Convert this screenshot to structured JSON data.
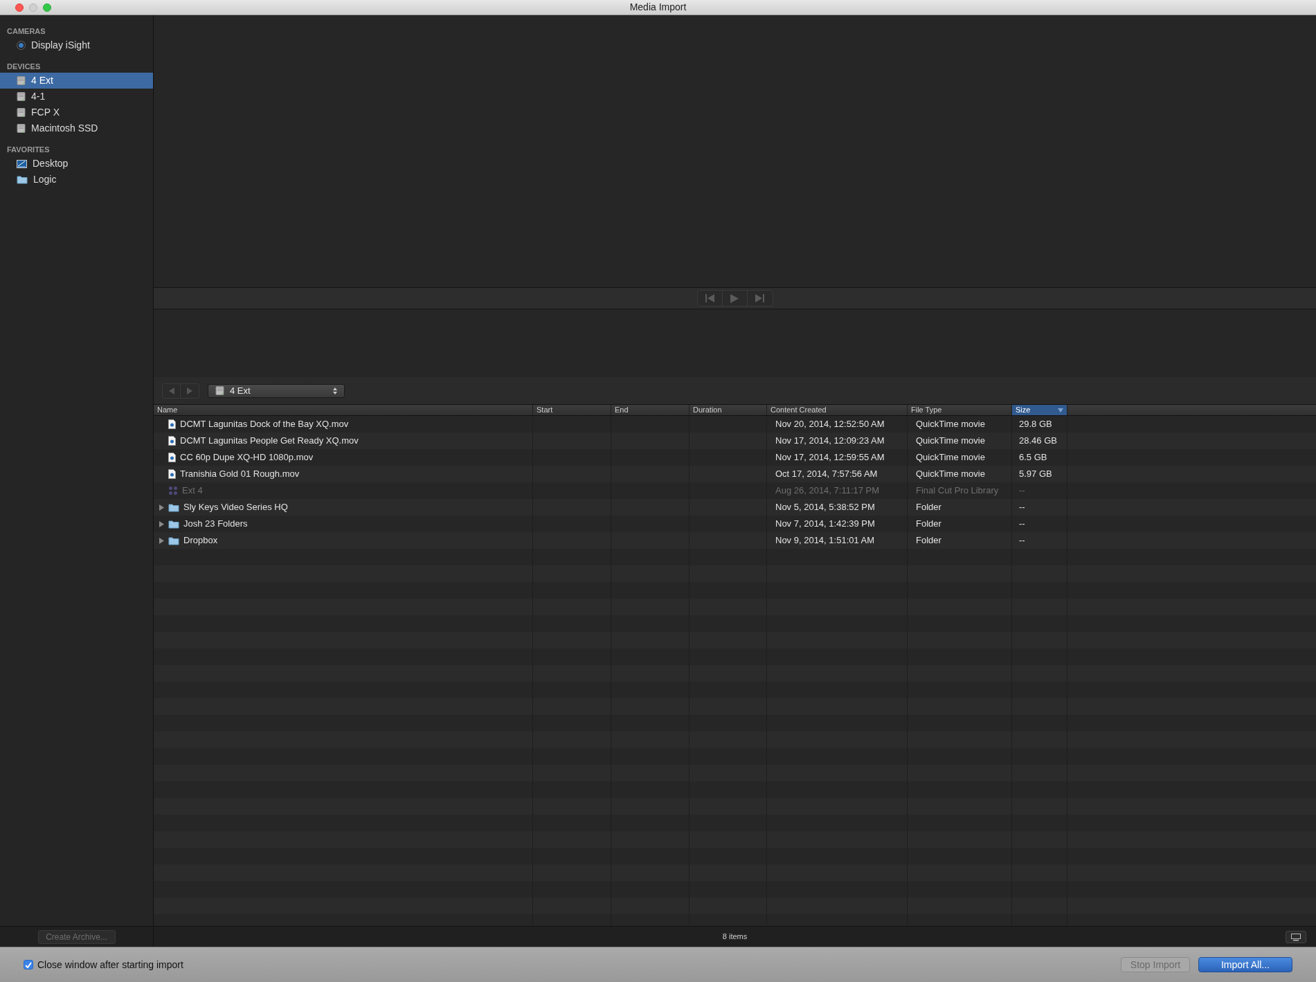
{
  "window": {
    "title": "Media Import"
  },
  "sidebar": {
    "sections": [
      {
        "title": "CAMERAS",
        "items": [
          {
            "label": "Display iSight",
            "kind": "camera",
            "selected": false
          }
        ]
      },
      {
        "title": "DEVICES",
        "items": [
          {
            "label": "4 Ext",
            "kind": "disk",
            "selected": true
          },
          {
            "label": "4-1",
            "kind": "disk",
            "selected": false
          },
          {
            "label": "FCP X",
            "kind": "disk",
            "selected": false
          },
          {
            "label": "Macintosh SSD",
            "kind": "disk",
            "selected": false
          }
        ]
      },
      {
        "title": "FAVORITES",
        "items": [
          {
            "label": "Desktop",
            "kind": "desktop",
            "selected": false
          },
          {
            "label": "Logic",
            "kind": "folder",
            "selected": false
          }
        ]
      }
    ],
    "create_archive": {
      "label": "Create Archive...",
      "disabled": true
    }
  },
  "location": {
    "value": "4 Ext"
  },
  "table": {
    "columns": [
      {
        "label": "Name",
        "sorted": false
      },
      {
        "label": "Start",
        "sorted": false
      },
      {
        "label": "End",
        "sorted": false
      },
      {
        "label": "Duration",
        "sorted": false
      },
      {
        "label": "Content Created",
        "sorted": false
      },
      {
        "label": "File Type",
        "sorted": false
      },
      {
        "label": "Size",
        "sorted": true
      }
    ],
    "rows": [
      {
        "kind": "file",
        "name": "DCMT Lagunitas Dock of the Bay XQ.mov",
        "created": "Nov 20, 2014, 12:52:50 AM",
        "type": "QuickTime movie",
        "size": "29.8 GB",
        "disabled": false
      },
      {
        "kind": "file",
        "name": "DCMT Lagunitas People Get Ready XQ.mov",
        "created": "Nov 17, 2014, 12:09:23 AM",
        "type": "QuickTime movie",
        "size": "28.46 GB",
        "disabled": false
      },
      {
        "kind": "file",
        "name": "CC 60p Dupe XQ-HD 1080p.mov",
        "created": "Nov 17, 2014, 12:59:55 AM",
        "type": "QuickTime movie",
        "size": "6.5 GB",
        "disabled": false
      },
      {
        "kind": "file",
        "name": "Tranishia Gold 01 Rough.mov",
        "created": "Oct 17, 2014, 7:57:56 AM",
        "type": "QuickTime movie",
        "size": "5.97 GB",
        "disabled": false
      },
      {
        "kind": "library",
        "name": "Ext 4",
        "created": "Aug 26, 2014, 7:11:17 PM",
        "type": "Final Cut Pro Library",
        "size": "--",
        "disabled": true
      },
      {
        "kind": "folder",
        "name": "Sly Keys Video Series HQ",
        "created": "Nov 5, 2014, 5:38:52 PM",
        "type": "Folder",
        "size": "--",
        "disabled": false
      },
      {
        "kind": "folder",
        "name": "Josh 23 Folders",
        "created": "Nov 7, 2014, 1:42:39 PM",
        "type": "Folder",
        "size": "--",
        "disabled": false
      },
      {
        "kind": "folder",
        "name": "Dropbox",
        "created": "Nov 9, 2014, 1:51:01 AM",
        "type": "Folder",
        "size": "--",
        "disabled": false
      }
    ]
  },
  "status": {
    "count": "8 items"
  },
  "footer": {
    "close_after_import": {
      "label": "Close window after starting import",
      "checked": true
    },
    "buttons": [
      {
        "label": "Stop Import",
        "kind": "plain",
        "disabled": true
      },
      {
        "label": "Import All...",
        "kind": "default",
        "disabled": false
      }
    ]
  }
}
